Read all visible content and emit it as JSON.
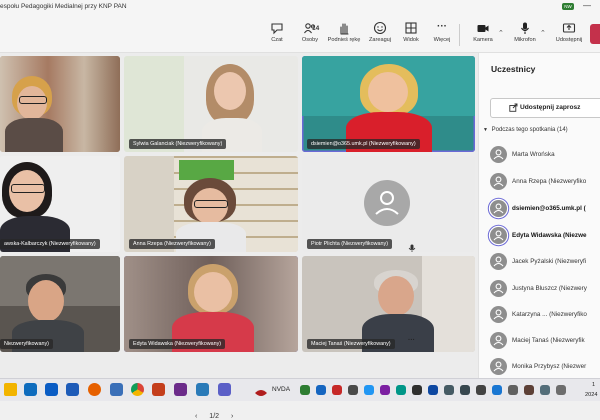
{
  "window": {
    "title": "espołu Pedagogiki Medialnej przy KNP PAN",
    "badge": "NW",
    "min_symbol": "—"
  },
  "toolbar": {
    "items": [
      {
        "label": "Czat",
        "icon": "chat-icon"
      },
      {
        "label": "Osoby",
        "icon": "people-icon",
        "count": "14"
      },
      {
        "label": "Podnieś rękę",
        "icon": "hand-icon"
      },
      {
        "label": "Zareaguj",
        "icon": "smiley-icon"
      },
      {
        "label": "Widok",
        "icon": "grid-icon"
      },
      {
        "label": "Więcej",
        "icon": "more-icon"
      },
      {
        "label": "Kamera",
        "icon": "camera-icon"
      },
      {
        "label": "Mikrofon",
        "icon": "mic-icon"
      },
      {
        "label": "Udostępnij",
        "icon": "share-icon"
      }
    ],
    "more_symbol": "···",
    "chevron": "⌃"
  },
  "grid": {
    "tiles": [
      {
        "name": ""
      },
      {
        "name": "Sylwia Galanciak (Niezweryfikowany)"
      },
      {
        "name": "dsiemien@o365.umk.pl (Niezweryfikowany)"
      },
      {
        "name": "awska-Kalbarczyk (Niezweryfikowany)"
      },
      {
        "name": "Anna Rzepa (Niezweryfikowany)"
      },
      {
        "name": "Piotr Plichta (Niezweryfikowany)"
      },
      {
        "name": "Niezweryfikowany)"
      },
      {
        "name": "Edyta Widawska (Niezweryfikowany)"
      },
      {
        "name": "Maciej Tanaś (Niezweryfikowany)"
      }
    ],
    "more_dots": "···",
    "pager": {
      "prev": "‹",
      "label": "1/2",
      "next": "›"
    }
  },
  "panel": {
    "title": "Uczestnicy",
    "share_button": "Udostępnij zaprosz",
    "section": "Podczas tego spotkania (14)",
    "participants": [
      {
        "name": "Marta Wrońska"
      },
      {
        "name": "Anna Rzepa (Niezweryfiko"
      },
      {
        "name": "dsiemien@o365.umk.pl ("
      },
      {
        "name": "Edyta Widawska (Niezwe"
      },
      {
        "name": "Jacek Pyżalski (Niezweryfi"
      },
      {
        "name": "Justyna Bluszcz (Niezwery"
      },
      {
        "name": "Katarzyna ... (Niezweryfiko"
      },
      {
        "name": "Maciej Tanaś (Niezweryfik"
      },
      {
        "name": "Monika Przybysz (Niezwer"
      }
    ]
  },
  "taskbar": {
    "nvda_label": "NVDA",
    "clock_top": "1",
    "clock_bottom": "2024"
  },
  "colors": {
    "accent": "#6b69d6",
    "leave": "#c4314b",
    "toolbar_bg": "#f5f5f5",
    "panel_bg": "#fafafa"
  }
}
